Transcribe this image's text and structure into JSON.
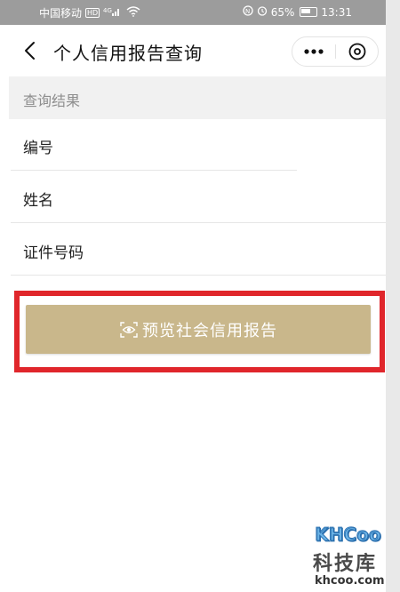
{
  "status_bar": {
    "carrier": "中国移动",
    "hd": "HD",
    "signal": "⁴ᴳ",
    "battery_pct": "65%",
    "time": "13:31"
  },
  "navbar": {
    "title": "个人信用报告查询"
  },
  "section": {
    "header": "查询结果"
  },
  "fields": [
    {
      "label": "编号"
    },
    {
      "label": "姓名"
    },
    {
      "label": "证件号码"
    }
  ],
  "preview_button": {
    "label": "预览社会信用报告"
  },
  "watermark": {
    "logo": "KHCoo",
    "name": "科技库",
    "url": "khcoo.com"
  },
  "colors": {
    "accent_gold": "#c9b78b",
    "highlight_red": "#e0262b",
    "status_bar": "#9c9c9c"
  }
}
